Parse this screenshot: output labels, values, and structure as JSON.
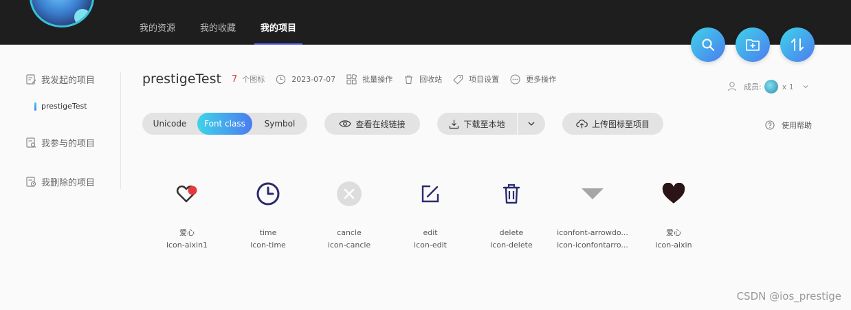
{
  "topnav": {
    "tabs": [
      {
        "label": "我的资源"
      },
      {
        "label": "我的收藏"
      },
      {
        "label": "我的项目",
        "active": true
      }
    ]
  },
  "fabs": [
    "search-icon",
    "folder-add-icon",
    "sort-icon"
  ],
  "sidebar": {
    "items": [
      {
        "label": "我发起的项目",
        "icon": "edit-doc-icon"
      },
      {
        "label": "我参与的项目",
        "icon": "doc-search-icon"
      },
      {
        "label": "我删除的项目",
        "icon": "doc-clock-icon"
      }
    ],
    "active_project": "prestigeTest"
  },
  "project": {
    "title": "prestigeTest",
    "count": "7",
    "count_label": "个图标",
    "date": "2023-07-07",
    "actions": [
      "批量操作",
      "回收站",
      "项目设置",
      "更多操作"
    ]
  },
  "members": {
    "label": "成员:",
    "count": "x 1"
  },
  "toolbar": {
    "formats": [
      "Unicode",
      "Font class",
      "Symbol"
    ],
    "active_format": "Font class",
    "view_link": "查看在线链接",
    "download": "下载至本地",
    "upload": "上传图标至项目",
    "help": "使用帮助"
  },
  "icons": [
    {
      "name": "爱心",
      "class": "icon-aixin1",
      "glyph": "heart-outline-icon"
    },
    {
      "name": "time",
      "class": "icon-time",
      "glyph": "clock-icon"
    },
    {
      "name": "cancle",
      "class": "icon-cancle",
      "glyph": "cancel-circle-icon"
    },
    {
      "name": "edit",
      "class": "icon-edit",
      "glyph": "edit-icon"
    },
    {
      "name": "delete",
      "class": "icon-delete",
      "glyph": "trash-icon"
    },
    {
      "name": "iconfont-arrowdo...",
      "class": "icon-iconfontarro...",
      "glyph": "triangle-down-icon"
    },
    {
      "name": "爱心",
      "class": "icon-aixin",
      "glyph": "heart-solid-icon"
    }
  ],
  "colors": {
    "accent_gradient_start": "#3fd3e8",
    "accent_gradient_end": "#4b7cf0",
    "topbar": "#1e1e1e",
    "count_red": "#e0383e",
    "icon_navy": "#2b2a6e"
  },
  "watermark": "CSDN @ios_prestige"
}
